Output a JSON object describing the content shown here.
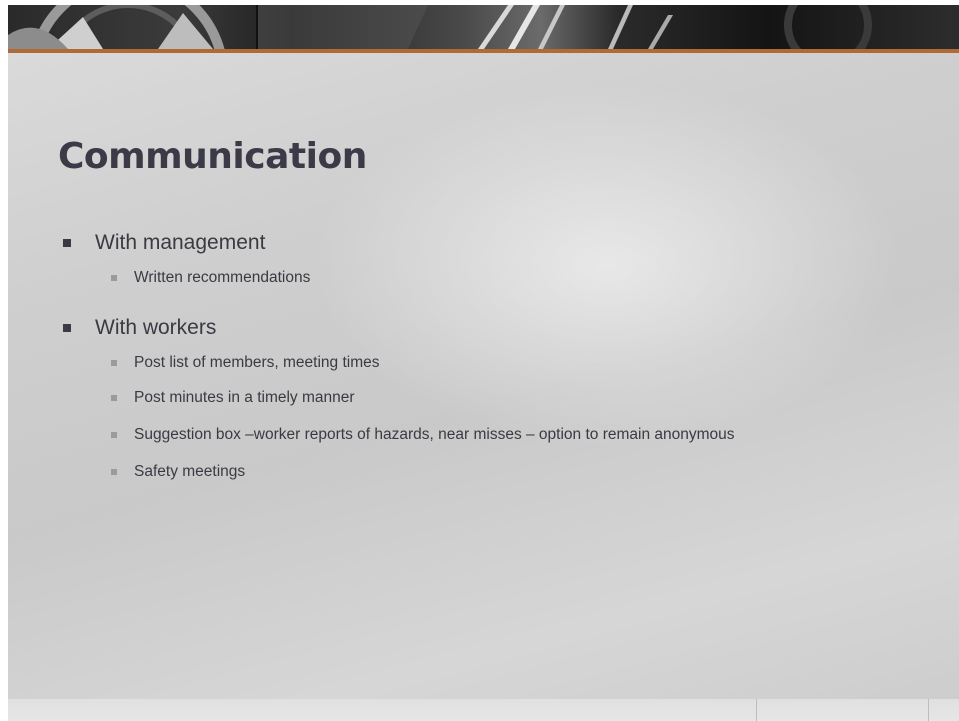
{
  "slide": {
    "title": "Communication",
    "bullets": [
      {
        "text": "With management",
        "subitems": [
          "Written recommendations"
        ]
      },
      {
        "text": "With workers",
        "subitems": [
          "Post list of members, meeting times",
          "Post minutes in a timely manner",
          "Suggestion box –worker reports of hazards, near misses – option to remain anonymous",
          "Safety meetings"
        ]
      }
    ]
  },
  "colors": {
    "accent_line": "#b06a35",
    "title_text": "#3d3a48",
    "body_text": "#3b3a42"
  }
}
